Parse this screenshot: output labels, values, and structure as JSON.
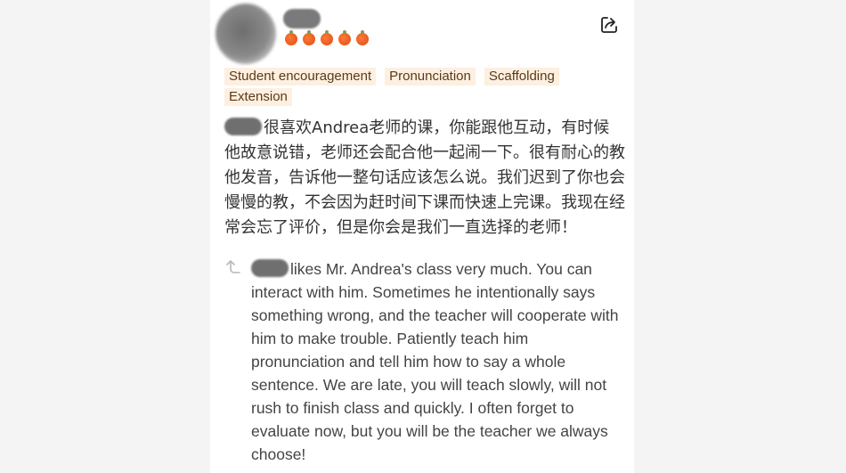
{
  "review": {
    "rating_count": 5,
    "tags": [
      "Student encouragement",
      "Pronunciation",
      "Scaffolding",
      "Extension"
    ],
    "text_zh": "很喜欢Andrea老师的课，你能跟他互动，有时候他故意说错，老师还会配合他一起闹一下。很有耐心的教他发音，告诉他一整句话应该怎么说。我们迟到了你也会慢慢的教，不会因为赶时间下课而快速上完课。我现在经常会忘了评价，但是你会是我们一直选择的老师！",
    "translation_en": "likes Mr. Andrea's class very much. You can interact with him. Sometimes he intentionally says something wrong, and the teacher will cooperate with him to make trouble. Patiently teach him pronunciation and tell him how to say a whole sentence. We are late, you will teach slowly, will not rush to finish class and quickly. I often forget to evaluate now, but you will be the teacher we always choose!"
  },
  "icons": {
    "share": "share-icon",
    "reply": "reply-arrow-icon",
    "rating": "orange-fruit-icon"
  },
  "colors": {
    "tag_bg": "#fdf0e0",
    "rating": "#ea5a1c"
  }
}
